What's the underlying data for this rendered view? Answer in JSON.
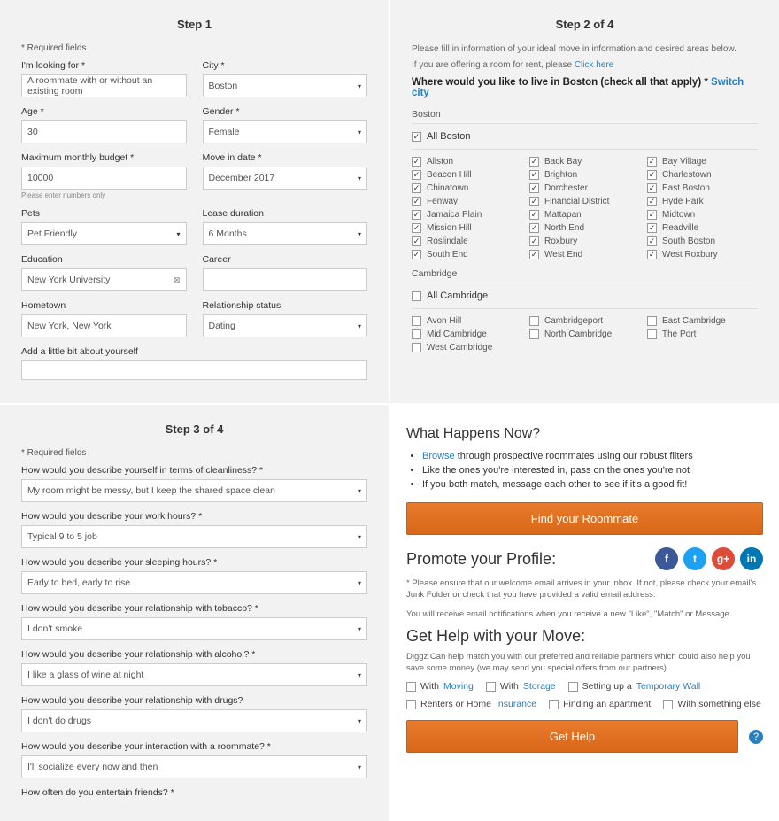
{
  "step1": {
    "title": "Step 1",
    "required": "* Required fields",
    "looking_for": {
      "label": "I'm looking for *",
      "value": "A roommate with or without an existing room"
    },
    "city": {
      "label": "City *",
      "value": "Boston"
    },
    "age": {
      "label": "Age *",
      "value": "30"
    },
    "gender": {
      "label": "Gender *",
      "value": "Female"
    },
    "budget": {
      "label": "Maximum monthly budget *",
      "value": "10000",
      "hint": "Please enter numbers only"
    },
    "movein": {
      "label": "Move in date *",
      "value": "December 2017"
    },
    "pets": {
      "label": "Pets",
      "value": "Pet Friendly"
    },
    "lease": {
      "label": "Lease duration",
      "value": "6 Months"
    },
    "education": {
      "label": "Education",
      "value": "New York University"
    },
    "career": {
      "label": "Career",
      "value": ""
    },
    "hometown": {
      "label": "Hometown",
      "value": "New York, New York"
    },
    "relationship": {
      "label": "Relationship status",
      "value": "Dating"
    },
    "about": {
      "label": "Add a little bit about yourself"
    }
  },
  "step2": {
    "title": "Step 2 of 4",
    "note1": "Please fill in information of your ideal move in information and desired areas below.",
    "note2a": "If you are offering a room for rent, please ",
    "note2b": "Click here",
    "question": "Where would you like to live in Boston (check all that apply) * ",
    "switch": "Switch city",
    "boston_head": "Boston",
    "all_boston": "All Boston",
    "boston": [
      "Allston",
      "Back Bay",
      "Bay Village",
      "Beacon Hill",
      "Brighton",
      "Charlestown",
      "Chinatown",
      "Dorchester",
      "East Boston",
      "Fenway",
      "Financial District",
      "Hyde Park",
      "Jamaica Plain",
      "Mattapan",
      "Midtown",
      "Mission Hill",
      "North End",
      "Readville",
      "Roslindale",
      "Roxbury",
      "South Boston",
      "South End",
      "West End",
      "West Roxbury"
    ],
    "cambridge_head": "Cambridge",
    "all_cambridge": "All Cambridge",
    "cambridge": [
      "Avon Hill",
      "Cambridgeport",
      "East Cambridge",
      "Mid Cambridge",
      "North Cambridge",
      "The Port",
      "West Cambridge"
    ]
  },
  "step3": {
    "title": "Step 3 of 4",
    "required": "* Required fields",
    "q": [
      {
        "label": "How would you describe yourself in terms of cleanliness? *",
        "value": "My room might be messy, but I keep the shared space clean"
      },
      {
        "label": "How would you describe your work hours? *",
        "value": "Typical 9 to 5 job"
      },
      {
        "label": "How would you describe your sleeping hours? *",
        "value": "Early to bed, early to rise"
      },
      {
        "label": "How would you describe your relationship with tobacco? *",
        "value": "I don't smoke"
      },
      {
        "label": "How would you describe your relationship with alcohol? *",
        "value": "I like a glass of wine at night"
      },
      {
        "label": "How would you describe your relationship with drugs?",
        "value": "I don't do drugs"
      },
      {
        "label": "How would you describe your interaction with a roommate? *",
        "value": "I'll socialize every now and then"
      },
      {
        "label": "How often do you entertain friends? *",
        "value": ""
      }
    ]
  },
  "step4": {
    "what_head": "What Happens Now?",
    "browse": "Browse",
    "b1_rest": " through prospective roommates using our robust filters",
    "b2": "Like the ones you're interested in, pass on the ones you're not",
    "b3": "If you both match, message each other to see if it's a good fit!",
    "find_btn": "Find your Roommate",
    "promote": "Promote your Profile:",
    "note_email": "* Please ensure that our welcome email arrives in your inbox. If not, please check your email's Junk Folder or check that you have provided a valid email address.",
    "note_notif": "You will receive email notifications when you receive a new \"Like\", \"Match\" or Message.",
    "gethelp": "Get Help with your Move:",
    "help_intro": "Diggz Can help match you with our preferred and reliable partners which could also help you save some money (we may send you special offers from our partners)",
    "opts": {
      "with": "With ",
      "moving": "Moving",
      "storage": "Storage",
      "tempwall_pre": "Setting up a ",
      "tempwall": "Temporary Wall",
      "insurance_pre": "Renters or Home ",
      "insurance": "Insurance",
      "apartment": "Finding an apartment",
      "something": "With something else"
    },
    "gethelp_btn": "Get Help"
  }
}
